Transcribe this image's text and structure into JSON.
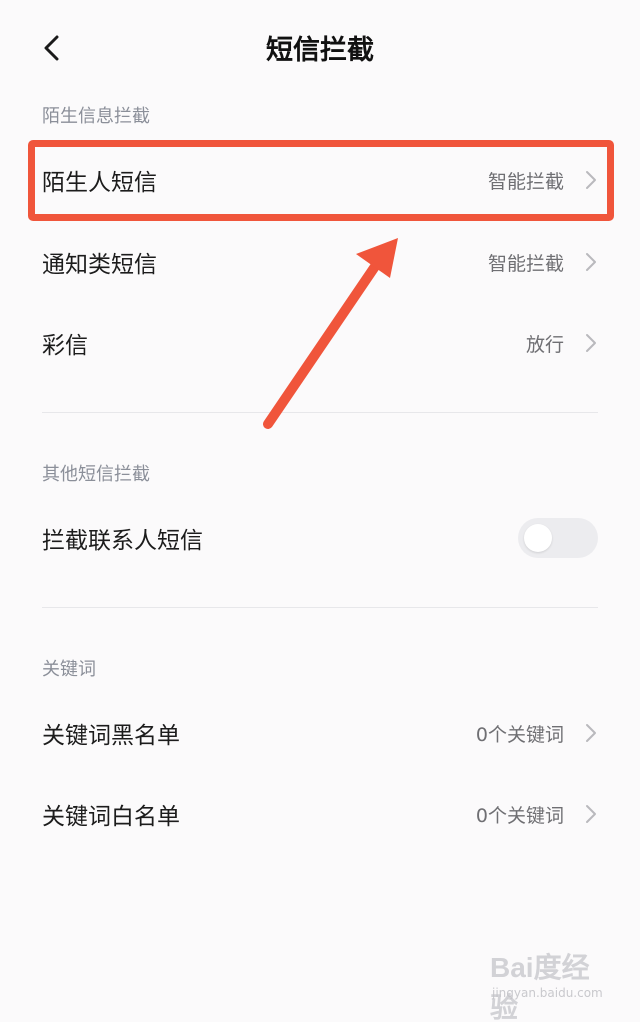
{
  "header": {
    "title": "短信拦截"
  },
  "sections": [
    {
      "title": "陌生信息拦截",
      "items": [
        {
          "label": "陌生人短信",
          "value": "智能拦截"
        },
        {
          "label": "通知类短信",
          "value": "智能拦截"
        },
        {
          "label": "彩信",
          "value": "放行"
        }
      ]
    },
    {
      "title": "其他短信拦截",
      "items": [
        {
          "label": "拦截联系人短信",
          "toggle_on": false
        }
      ]
    },
    {
      "title": "关键词",
      "items": [
        {
          "label": "关键词黑名单",
          "value": "0个关键词"
        },
        {
          "label": "关键词白名单",
          "value": "0个关键词"
        }
      ]
    }
  ],
  "annotation": {
    "highlight_color": "#f0553b"
  },
  "watermark": {
    "logo": "Bai度经验",
    "sub": "jingyan.baidu.com"
  }
}
